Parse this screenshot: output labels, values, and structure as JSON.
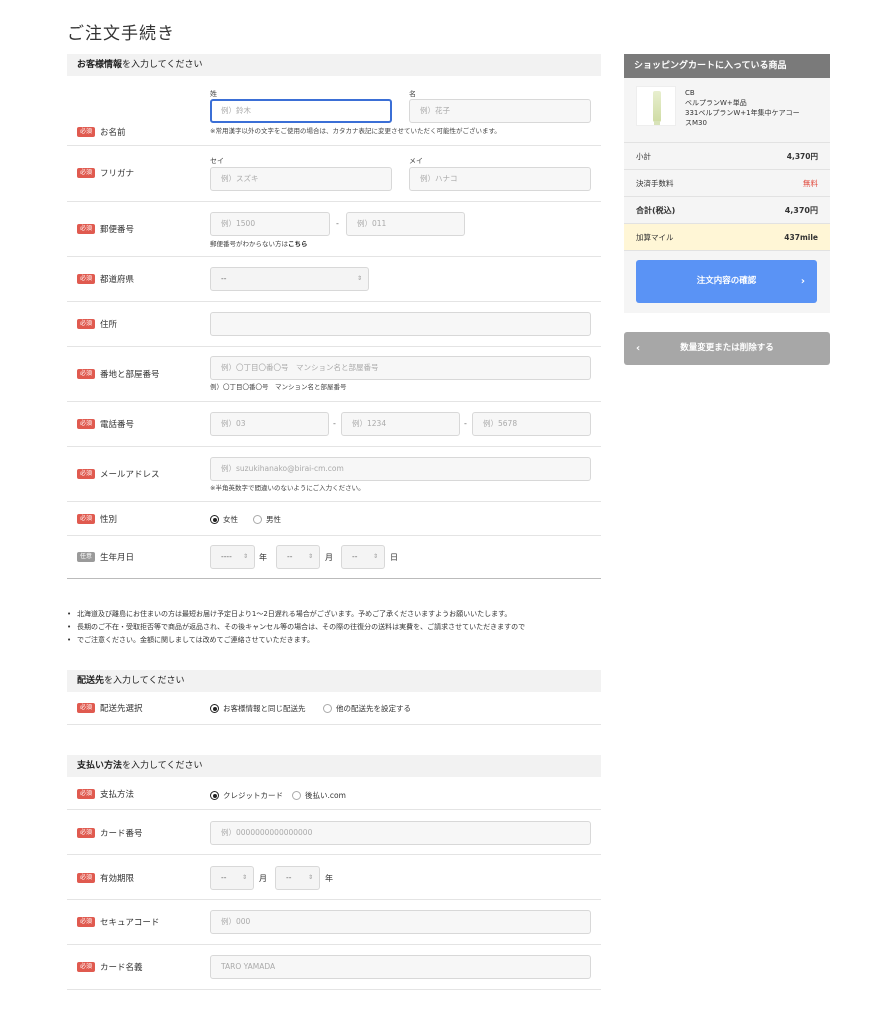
{
  "page_title": "ご注文手続き",
  "customer": {
    "head_bold": "お客様情報",
    "head_rest": "を入力してください",
    "required_badge": "必須",
    "optional_badge": "任意",
    "name": {
      "label": "お名前",
      "sei_label": "姓",
      "mei_label": "名",
      "sei_placeholder": "例）鈴木",
      "mei_placeholder": "例）花子",
      "note": "※常用漢字以外の文字をご使用の場合は、カタカナ表記に変更させていただく可能性がございます。"
    },
    "kana": {
      "label": "フリガナ",
      "sei_label": "セイ",
      "mei_label": "メイ",
      "sei_placeholder": "例）スズキ",
      "mei_placeholder": "例）ハナコ"
    },
    "zip": {
      "label": "郵便番号",
      "p1": "例）1500",
      "p2": "例）011",
      "dash": "-",
      "note_pre": "郵便番号がわからない方は",
      "note_link": "こちら"
    },
    "pref": {
      "label": "都道府県",
      "value": "--"
    },
    "address": {
      "label": "住所",
      "placeholder": ""
    },
    "building": {
      "label": "番地と部屋番号",
      "placeholder": "例）〇丁目〇番〇号　マンション名と部屋番号",
      "note": "例）〇丁目〇番〇号　マンション名と部屋番号"
    },
    "phone": {
      "label": "電話番号",
      "p1": "例）03",
      "p2": "例）1234",
      "p3": "例）5678",
      "dash": "-"
    },
    "email": {
      "label": "メールアドレス",
      "placeholder": "例）suzukihanako@birai-cm.com",
      "note": "※半角英数字で間違いのないようにご入力ください。"
    },
    "gender": {
      "label": "性別",
      "opt1": "女性",
      "opt2": "男性",
      "selected": "女性"
    },
    "birth": {
      "label": "生年月日",
      "year": "----",
      "month": "--",
      "day": "--",
      "u_year": "年",
      "u_month": "月",
      "u_day": "日"
    }
  },
  "notes": [
    "北海道及び離島にお住まいの方は最短お届け予定日より1〜2日遅れる場合がございます。予めご了承くださいますようお願いいたします。",
    "長期のご不在・受取拒否等で商品が返品され、その後キャンセル等の場合は、その際の往復分の送料は実費を、ご請求させていただきますので",
    "でご注意ください。金額に関しましては改めてご連絡させていただきます。"
  ],
  "shipping": {
    "head_bold": "配送先",
    "head_rest": "を入力してください",
    "label": "配送先選択",
    "opt1": "お客様情報と同じ配送先",
    "opt2": "他の配送先を設定する"
  },
  "payment": {
    "head_bold": "支払い方法",
    "head_rest": "を入力してください",
    "method_label": "支払方法",
    "opt1": "クレジットカード",
    "opt2": "後払い.com",
    "card_label": "カード番号",
    "card_placeholder": "例）0000000000000000",
    "expiry_label": "有効期限",
    "exp_month": "--",
    "exp_year": "--",
    "u_month": "月",
    "u_year": "年",
    "cvc_label": "セキュアコード",
    "cvc_placeholder": "例）000",
    "holder_label": "カード名義",
    "holder_placeholder": "TARO YAMADA"
  },
  "cart": {
    "title": "ショッピングカートに入っている商品",
    "item_line1": "CB",
    "item_line2": "ベルプランW+単品",
    "item_line3": "331ベルプランW+1年集中ケアコー",
    "item_line4": "スM30",
    "subtotal_label": "小計",
    "subtotal_value": "4,370円",
    "fee_label": "決済手数料",
    "fee_value": "無料",
    "total_label": "合計(税込)",
    "total_value": "4,370円",
    "mile_label": "加算マイル",
    "mile_value": "437mile",
    "confirm_button": "注文内容の確認",
    "back_button": "数量変更または削除する"
  },
  "colors": {
    "accent": "#5a93f5",
    "required": "#e05a4f",
    "free": "#e0473a",
    "mile_bg": "#fff6d6"
  }
}
